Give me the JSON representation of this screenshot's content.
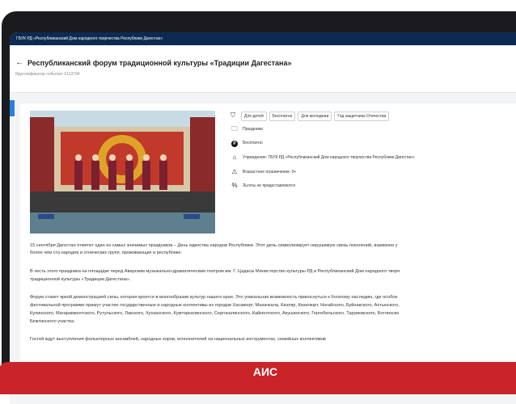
{
  "org": "ГБУК РД «Республиканский Дом народного творчества Республики Дагестан»",
  "header": {
    "title": "Республиканский форум традиционной культуры «Традиции Дагестана»",
    "event_id": "Идентификатор события: 6113794"
  },
  "tags": [
    "Для детей",
    "Бесплатно",
    "Для молодежи",
    "Год защитника Отечества"
  ],
  "info": {
    "category": "Праздники",
    "price": "Бесплатно",
    "institution": "Учреждение: ГБУК РД «Республиканский Дом народного творчества Республики Дагестан»",
    "age": "Возрастное ограничение: 0+",
    "benefits": "Льготы не предоставляются"
  },
  "description": [
    "15 сентября Дагестан отметит один из самых значимых праздников – День единства народов Республики. Этот день символизирует нерушимую связь поколений, взаимное у",
    "более чем ста народов и этнических групп, проживающих в республике.",
    "В честь этого праздника на площадке перед Аварским музыкально-драматическим театром им. Г. Цадасы Министерство культуры РД и Республиканский Дом народного творч",
    "традиционной культуры «Традиции Дагестана».",
    "Форум станет яркой демонстрацией силы, которая кроется в многообразии культур нашего края. Это уникальная возможность прикоснуться к богатому наследию, где особое",
    "фестивальной программе примут участие государственные и народные коллективы из городов Хасавюрт, Махачкала, Кизляр, Кизилюрт, Ногайского, Буйнакского, Ахтынского,",
    "Кулинского, Магарамкентского, Рутульского, Лакского, Хунзахского, Кумторкалинского, Сергокалинского, Кайкентского, Акушинского, Гергебильского, Тарумовского, Ботлихско",
    "Бежтинского участка.",
    "Гостей ждут выступления фольклорных ансамблей, народных хоров, исполнителей на национальных инструментах, семейных коллективов"
  ],
  "footer": "АИС",
  "colors": {
    "topbar": "#0d2b52",
    "accent": "#2e7de1",
    "footer": "#c8242a"
  }
}
